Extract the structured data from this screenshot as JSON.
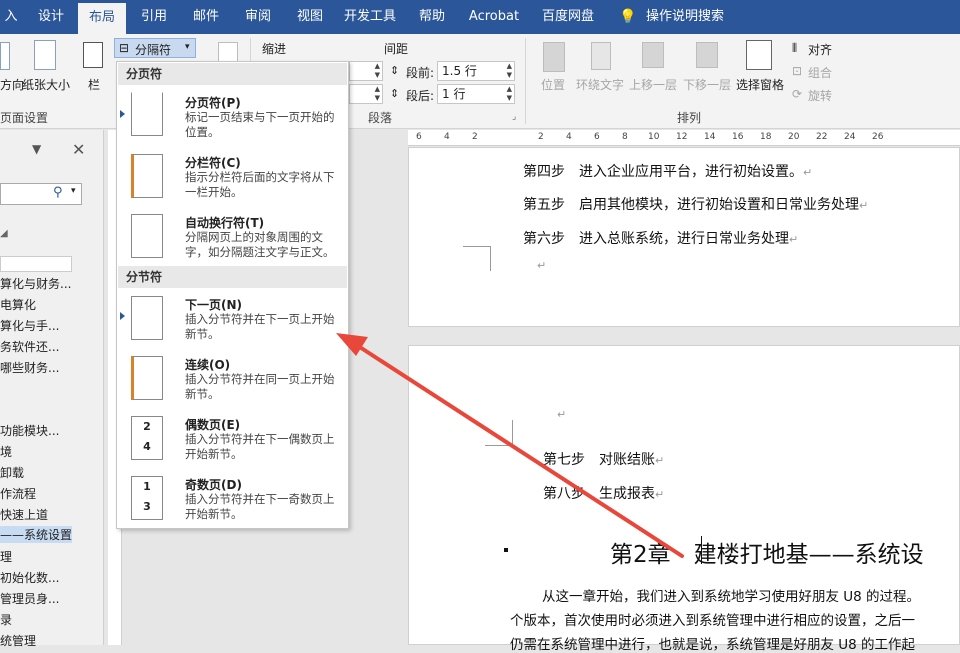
{
  "tabs": [
    "入",
    "设计",
    "布局",
    "引用",
    "邮件",
    "审阅",
    "视图",
    "开发工具",
    "帮助",
    "Acrobat",
    "百度网盘",
    "操作说明搜索"
  ],
  "ribbon": {
    "breaks_button": "分隔符",
    "orientation": "方向",
    "paper_size": "纸张大小",
    "columns": "栏",
    "page_setup_label": "页面设置",
    "indent_label": "缩进",
    "spacing_label": "间距",
    "before_label": "段前:",
    "before_value": "1.5 行",
    "after_label": "段后:",
    "after_value": "1 行",
    "paragraph_label": "段落",
    "position": "位置",
    "wrap_text": "环绕文字",
    "bring_forward": "上移一层",
    "send_backward": "下移一层",
    "selection_pane": "选择窗格",
    "align": "对齐",
    "group": "组合",
    "rotate": "旋转",
    "arrange_label": "排列"
  },
  "nav": {
    "items": [
      "算化与财务...",
      "电算化",
      "算化与手...",
      "务软件还...",
      "哪些财务...",
      "功能模块...",
      "境",
      "卸载",
      "作流程",
      "快速上道",
      "——系统设置",
      "理",
      "初始化数...",
      "管理员身...",
      "录",
      "统管理"
    ],
    "selected_index": 10
  },
  "menu": {
    "page_breaks_header": "分页符",
    "section_breaks_header": "分节符",
    "items": [
      {
        "title": "分页符(P)",
        "desc": "标记一页结束与下一页开始的位置。"
      },
      {
        "title": "分栏符(C)",
        "desc": "指示分栏符后面的文字将从下一栏开始。"
      },
      {
        "title": "自动换行符(T)",
        "desc": "分隔网页上的对象周围的文字，如分隔题注文字与正文。"
      },
      {
        "title": "下一页(N)",
        "desc": "插入分节符并在下一页上开始新节。"
      },
      {
        "title": "连续(O)",
        "desc": "插入分节符并在同一页上开始新节。"
      },
      {
        "title": "偶数页(E)",
        "desc": "插入分节符并在下一偶数页上开始新节。"
      },
      {
        "title": "奇数页(D)",
        "desc": "插入分节符并在下一奇数页上开始新节。"
      }
    ]
  },
  "ruler": {
    "numbers": [
      "6",
      "4",
      "2",
      "2",
      "4",
      "6",
      "8",
      "10",
      "12",
      "14",
      "16",
      "18",
      "20",
      "22",
      "24",
      "26"
    ]
  },
  "document": {
    "page1_lines": [
      "第四步　进入企业应用平台，进行初始设置。",
      "第五步　启用其他模块，进行初始设置和日常业务处理",
      "第六步　进入总账系统，进行日常业务处理"
    ],
    "page2_lines": [
      "第七步　对账结账",
      "第八步　生成报表"
    ],
    "chapter_heading": "第2章　建楼打地基——系统设",
    "body_lines": [
      "从这一章开始，我们进入到系统地学习使用好朋友 U8 的过程。",
      "个版本，首次使用时必须进入到系统管理中进行相应的设置，之后一",
      "仍需在系统管理中进行，也就是说，系统管理是好朋友 U8 的工作起"
    ],
    "para_mark": "↵"
  },
  "colors": {
    "ribbon_blue": "#2b579a",
    "arrow_red": "#e8473a"
  }
}
